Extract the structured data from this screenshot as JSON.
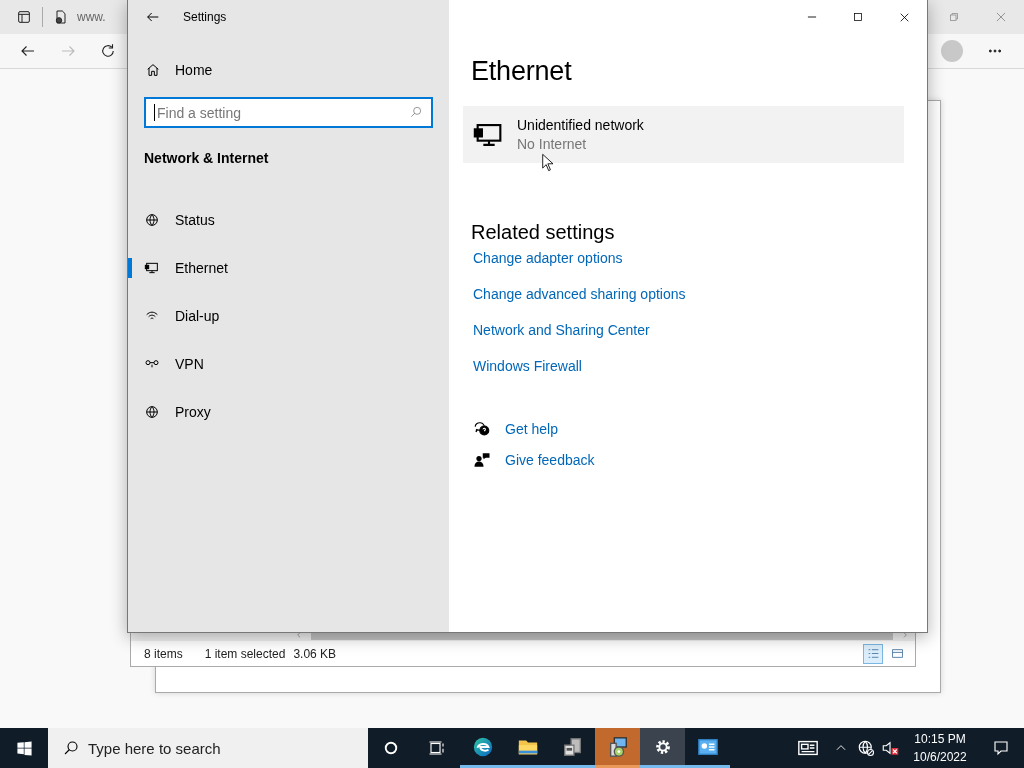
{
  "browser": {
    "tab_title": "www."
  },
  "explorer": {
    "status_bar": {
      "item_count": "8 items",
      "selection": "1 item selected",
      "size": "3.06 KB"
    },
    "view_buttons": [
      {
        "kind": "details",
        "selected": true
      },
      {
        "kind": "large-icons",
        "selected": false
      }
    ]
  },
  "settings": {
    "window": {
      "title": "Settings"
    },
    "home": "Home",
    "search": {
      "placeholder": "Find a setting"
    },
    "section": "Network & Internet",
    "nav_items": [
      {
        "kind": "status",
        "label": "Status",
        "selected": false
      },
      {
        "kind": "ethernet",
        "label": "Ethernet",
        "selected": true
      },
      {
        "kind": "dialup",
        "label": "Dial-up",
        "selected": false
      },
      {
        "kind": "vpn",
        "label": "VPN",
        "selected": false
      },
      {
        "kind": "proxy",
        "label": "Proxy",
        "selected": false
      }
    ],
    "page_title": "Ethernet",
    "network": {
      "name": "Unidentified network",
      "status": "No Internet"
    },
    "related_heading": "Related settings",
    "related_links": [
      "Change adapter options",
      "Change advanced sharing options",
      "Network and Sharing Center",
      "Windows Firewall"
    ],
    "help_links": [
      {
        "kind": "help",
        "label": "Get help"
      },
      {
        "kind": "feedback",
        "label": "Give feedback"
      }
    ]
  },
  "taskbar": {
    "search": {
      "placeholder": "Type here to search"
    },
    "apps": [
      {
        "kind": "edge",
        "running": true,
        "selected": false,
        "flashing": false
      },
      {
        "kind": "folder",
        "running": true,
        "selected": false,
        "flashing": false
      },
      {
        "kind": "server",
        "running": true,
        "selected": false,
        "flashing": false
      },
      {
        "kind": "setup",
        "running": true,
        "selected": false,
        "flashing": true
      },
      {
        "kind": "settings",
        "running": true,
        "selected": true,
        "flashing": false
      },
      {
        "kind": "panel",
        "running": true,
        "selected": false,
        "flashing": false
      }
    ],
    "time": "10:15 PM",
    "date": "10/6/2022"
  }
}
